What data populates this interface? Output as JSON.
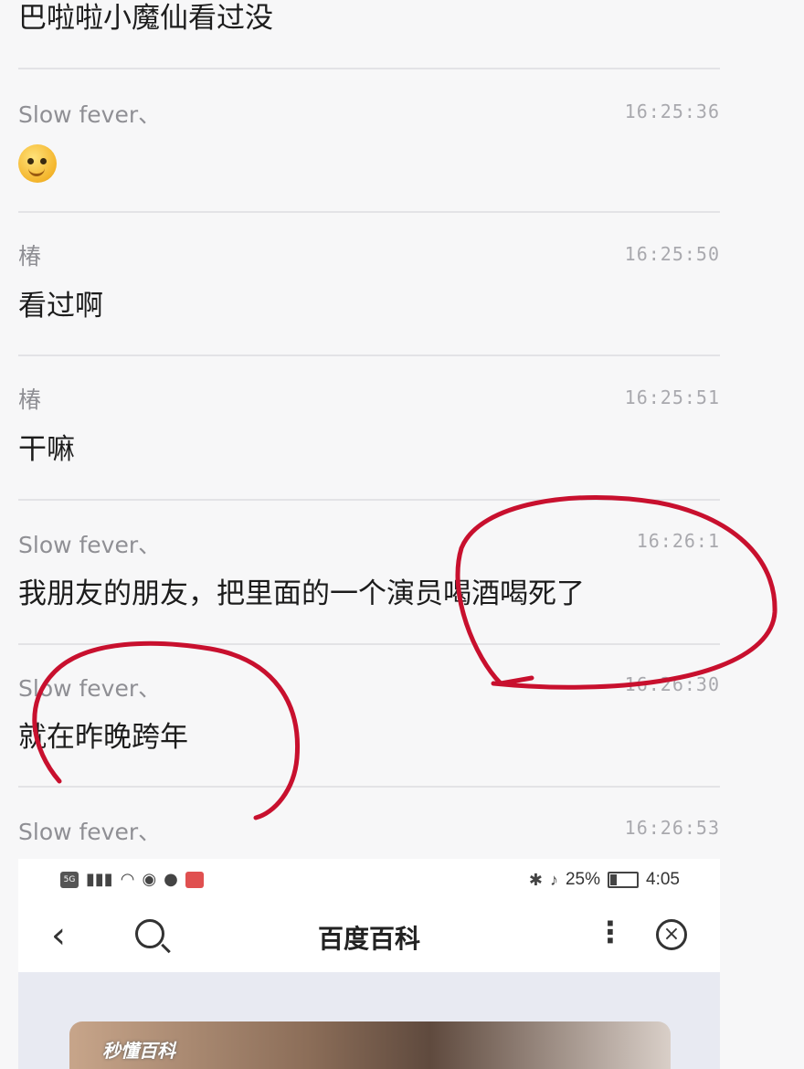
{
  "chat": {
    "top_message": "巴啦啦小魔仙看过没",
    "messages": [
      {
        "sender": "Slow fever、",
        "time": "16:25:36",
        "text": "",
        "emoji": "smirk-face-emoji"
      },
      {
        "sender": "椿",
        "time": "16:25:50",
        "text": "看过啊"
      },
      {
        "sender": "椿",
        "time": "16:25:51",
        "text": "干嘛"
      },
      {
        "sender": "Slow fever、",
        "time": "16:26:1",
        "text": "我朋友的朋友，把里面的一个演员喝酒喝死了"
      },
      {
        "sender": "Slow fever、",
        "time": "16:26:30",
        "text": "就在昨晚跨年"
      },
      {
        "sender": "Slow fever、",
        "time": "16:26:53",
        "text": ""
      }
    ]
  },
  "embedded_phone": {
    "status_left": [
      "5G",
      "wifi-icon",
      "chat-icon",
      "app-icon"
    ],
    "battery_text": "25%",
    "clock": "4:05",
    "nav_title": "百度百科",
    "thumbnail_tag": "秒懂百科"
  },
  "annotation_color": "#c8102e"
}
